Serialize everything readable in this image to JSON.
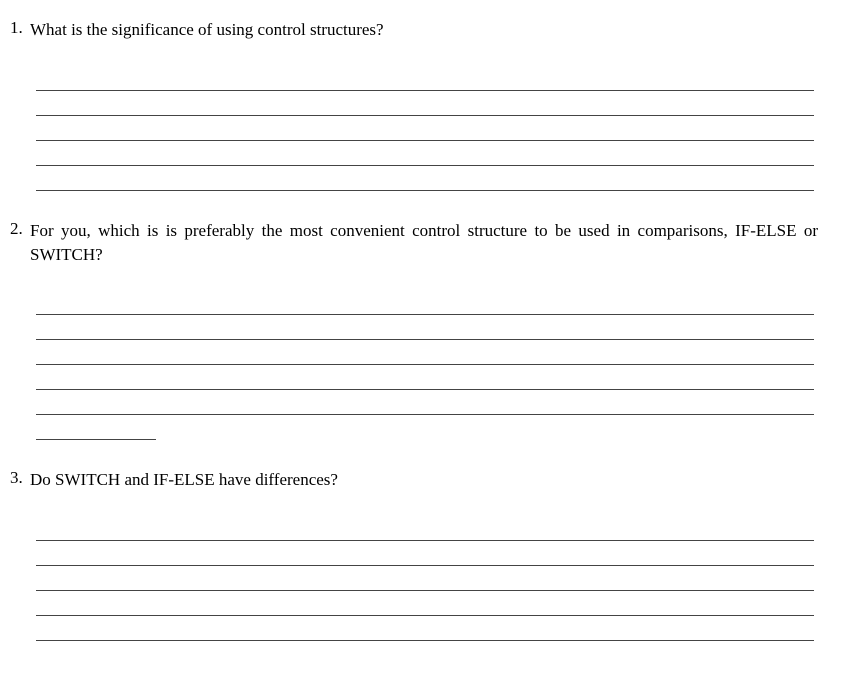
{
  "questions": [
    {
      "number": "1.",
      "text": "What is the significance of using control structures?",
      "lines": 5,
      "hasExtraShort": false
    },
    {
      "number": "2.",
      "text": "For you, which is is preferably the most convenient control structure to be used in comparisons, IF-ELSE or SWITCH?",
      "lines": 5,
      "hasExtraShort": true
    },
    {
      "number": "3.",
      "text": "Do SWITCH and IF-ELSE have differences?",
      "lines": 5,
      "hasExtraShort": false
    }
  ]
}
